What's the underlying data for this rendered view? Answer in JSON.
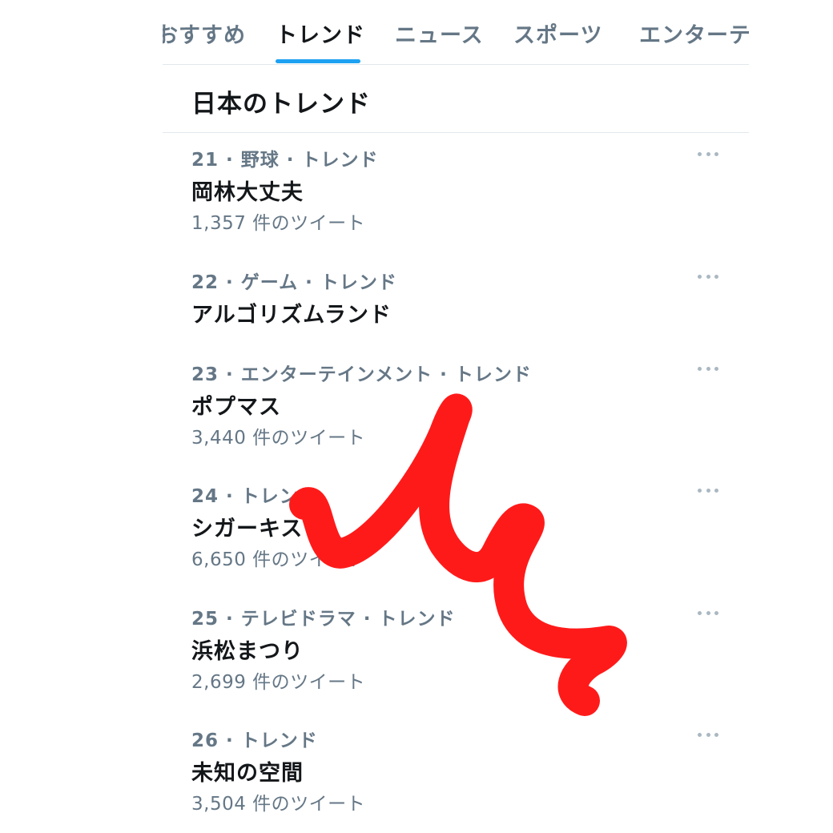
{
  "tabs": [
    {
      "label": "おすすめ"
    },
    {
      "label": "トレンド",
      "active": true
    },
    {
      "label": "ニュース"
    },
    {
      "label": "スポーツ"
    },
    {
      "label": "エンターテ"
    }
  ],
  "section_title": "日本のトレンド",
  "trends": [
    {
      "meta": "21 · 野球 · トレンド",
      "name": "岡林大丈夫",
      "count": "1,357 件のツイート"
    },
    {
      "meta": "22 · ゲーム · トレンド",
      "name": "アルゴリズムランド",
      "count": ""
    },
    {
      "meta": "23 · エンターテインメント · トレンド",
      "name": "ポプマス",
      "count": "3,440 件のツイート"
    },
    {
      "meta": "24 · トレンド",
      "name": "シガーキス",
      "count": "6,650 件のツイート"
    },
    {
      "meta": "25 · テレビドラマ · トレンド",
      "name": "浜松まつり",
      "count": "2,699 件のツイート"
    },
    {
      "meta": "26 · トレンド",
      "name": "未知の空間",
      "count": "3,504 件のツイート"
    }
  ],
  "colors": {
    "accent": "#1da1f2",
    "primary_text": "#14171a",
    "secondary_text": "#657786",
    "scribble": "#ff1a1a"
  }
}
